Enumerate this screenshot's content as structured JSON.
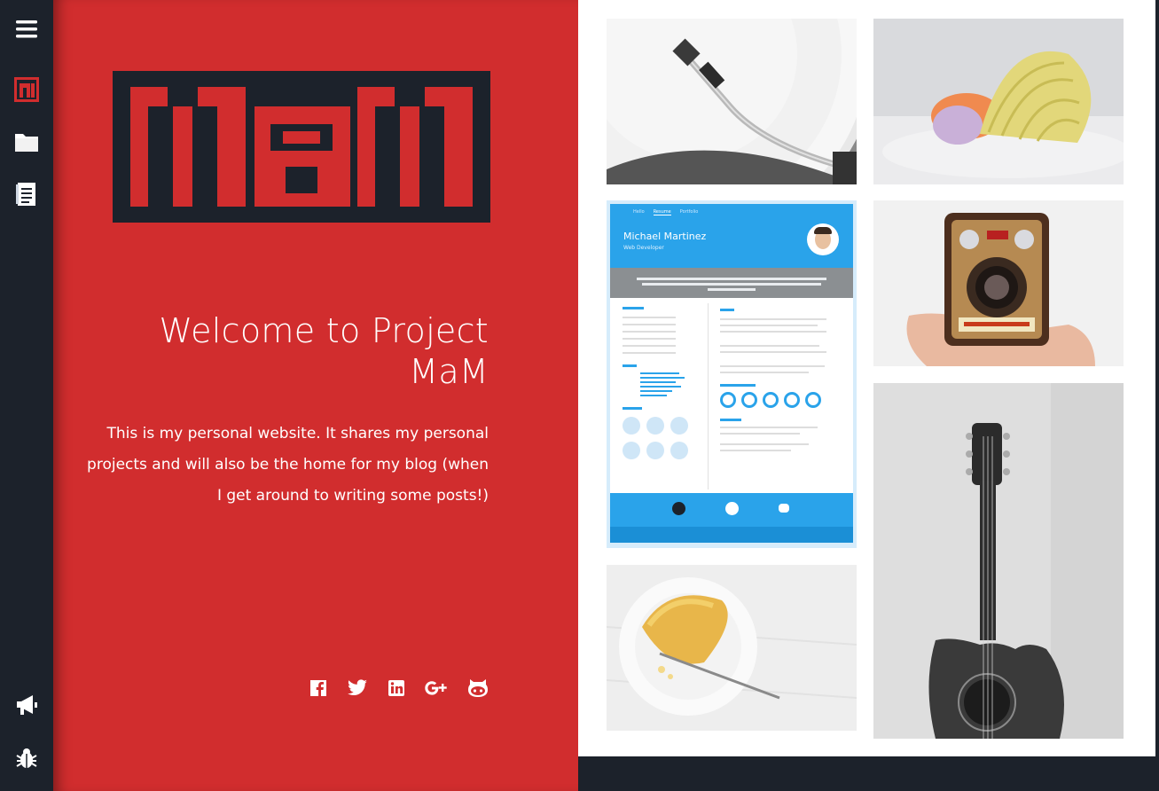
{
  "sidebar": {
    "items": [
      {
        "icon": "menu-icon"
      },
      {
        "icon": "mam-logo-icon",
        "color": "#d12d2e"
      },
      {
        "icon": "folder-icon"
      },
      {
        "icon": "document-icon"
      },
      {
        "icon": "megaphone-icon"
      },
      {
        "icon": "bug-icon"
      }
    ]
  },
  "hero": {
    "logo_text": "MaM",
    "title": "Welcome to Project MaM",
    "description": "This is my personal website. It shares my personal projects and will also be the home for my blog (when I get around to writing some posts!)",
    "social": [
      "facebook-icon",
      "twitter-icon",
      "linkedin-icon",
      "google-plus-icon",
      "github-icon"
    ]
  },
  "resume": {
    "tabs": [
      "Hello",
      "Resume",
      "Portfolio"
    ],
    "name": "Michael Martinez",
    "role": "Web Developer"
  },
  "colors": {
    "brand_red": "#d12d2e",
    "dark": "#1c222b",
    "resume_blue": "#2aa3ea"
  }
}
